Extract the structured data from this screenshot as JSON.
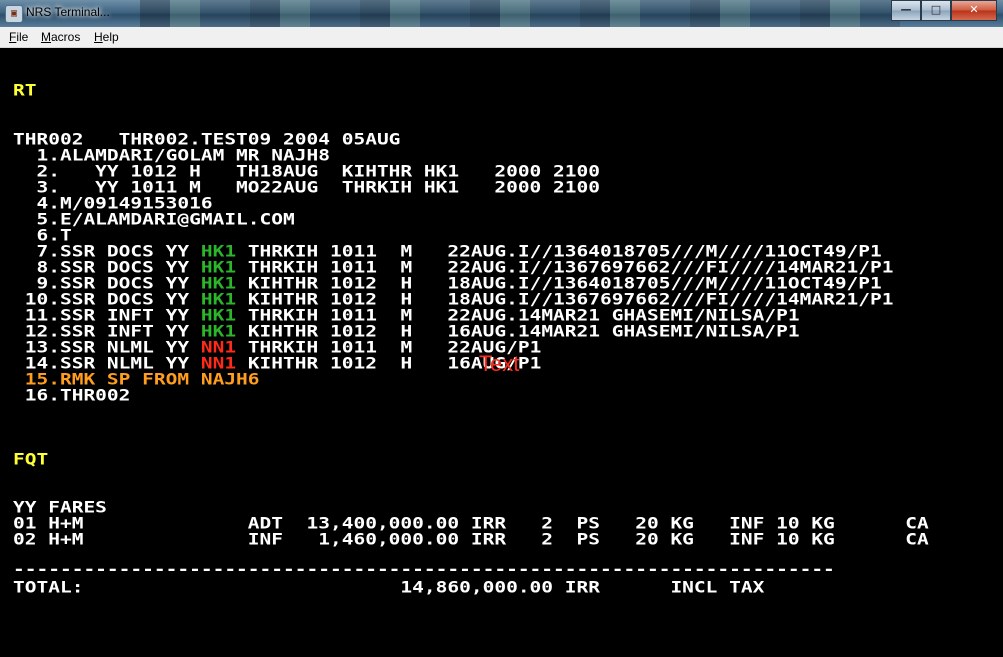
{
  "window": {
    "title": "NRS Terminal...",
    "minimize": "—",
    "maximize": "□",
    "close": "✕"
  },
  "menu": {
    "file": {
      "hot": "F",
      "rest": "ile"
    },
    "macros": {
      "hot": "M",
      "rest": "acros"
    },
    "help": {
      "hot": "H",
      "rest": "elp"
    }
  },
  "colors": {
    "background": "#000000",
    "text": "#ffffff",
    "section_header": "#ffff33",
    "remark": "#ff9d1f",
    "status_confirmed": "#2bb52b",
    "status_needs": "#ff2a1a"
  },
  "terminal": {
    "rt_header": "RT",
    "pnr_header": "THR002   THR002.TEST09 2004 05AUG",
    "pnr_lines": [
      {
        "pre": "  1.ALAMDARI/GOLAM MR NAJH8",
        "status": "",
        "post": ""
      },
      {
        "pre": "  2.   YY 1012 H   TH18AUG  KIHTHR HK1   2000 2100",
        "status": "",
        "post": ""
      },
      {
        "pre": "  3.   YY 1011 M   MO22AUG  THRKIH HK1   2000 2100",
        "status": "",
        "post": ""
      },
      {
        "pre": "  4.M/09149153016",
        "status": "",
        "post": ""
      },
      {
        "pre": "  5.E/ALAMDARI@GMAIL.COM",
        "status": "",
        "post": ""
      },
      {
        "pre": "  6.T",
        "status": "",
        "post": ""
      },
      {
        "pre": "  7.SSR DOCS YY ",
        "status": "HK1",
        "post": " THRKIH 1011  M   22AUG.I//1364018705///M////11OCT49/P1"
      },
      {
        "pre": "  8.SSR DOCS YY ",
        "status": "HK1",
        "post": " THRKIH 1011  M   22AUG.I//1367697662///FI////14MAR21/P1"
      },
      {
        "pre": "  9.SSR DOCS YY ",
        "status": "HK1",
        "post": " KIHTHR 1012  H   18AUG.I//1364018705///M////11OCT49/P1"
      },
      {
        "pre": " 10.SSR DOCS YY ",
        "status": "HK1",
        "post": " KIHTHR 1012  H   18AUG.I//1367697662///FI////14MAR21/P1"
      },
      {
        "pre": " 11.SSR INFT YY ",
        "status": "HK1",
        "post": " THRKIH 1011  M   22AUG.14MAR21 GHASEMI/NILSA/P1"
      },
      {
        "pre": " 12.SSR INFT YY ",
        "status": "HK1",
        "post": " KIHTHR 1012  H   16AUG.14MAR21 GHASEMI/NILSA/P1"
      },
      {
        "pre": " 13.SSR NLML YY ",
        "status": "NN1",
        "post": " THRKIH 1011  M   22AUG/P1"
      },
      {
        "pre": " 14.SSR NLML YY ",
        "status": "NN1",
        "post": " KIHTHR 1012  H   16AUG/P1"
      }
    ],
    "remark_line": " 15.RMK SP FROM NAJH6",
    "last_line": " 16.THR002",
    "overlay_text": "Text",
    "fqt_header": "FQT",
    "fares_header": "YY FARES",
    "fare_lines": [
      "01 H+M              ADT  13,400,000.00 IRR   2  PS   20 KG   INF 10 KG      CA",
      "02 H+M              INF   1,460,000.00 IRR   2  PS   20 KG   INF 10 KG      CA"
    ],
    "separator": "----------------------------------------------------------------------",
    "total_line": "TOTAL:                           14,860,000.00 IRR      INCL TAX"
  }
}
